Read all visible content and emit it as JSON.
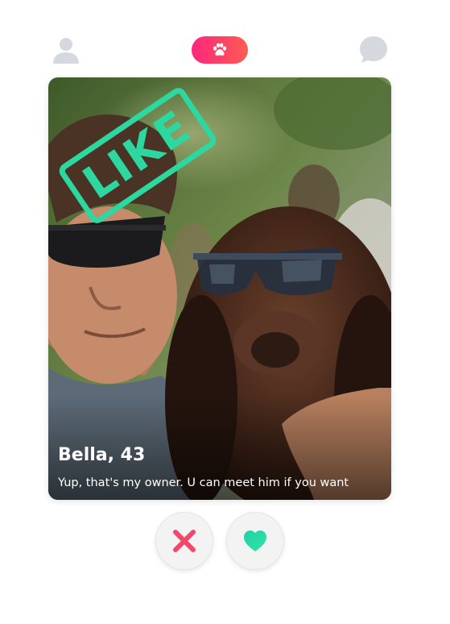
{
  "header": {
    "profile_icon": "user-icon",
    "center_icon": "paw-icon",
    "chat_icon": "chat-bubble-icon",
    "pill_color_start": "#fd267d",
    "pill_color_end": "#ff5c52",
    "icon_color": "#d5d8de"
  },
  "card": {
    "name": "Bella, 43",
    "bio": "Yup, that's my owner. U can meet him if you want",
    "stamp_label": "LIKE",
    "stamp_color": "#2dd8a0",
    "photo": "photo of a man and a brown spaniel, both wearing sunglasses"
  },
  "actions": {
    "nope_icon": "close-icon",
    "nope_color": "#f2486b",
    "like_icon": "heart-icon",
    "like_color": "#26d4a3"
  }
}
